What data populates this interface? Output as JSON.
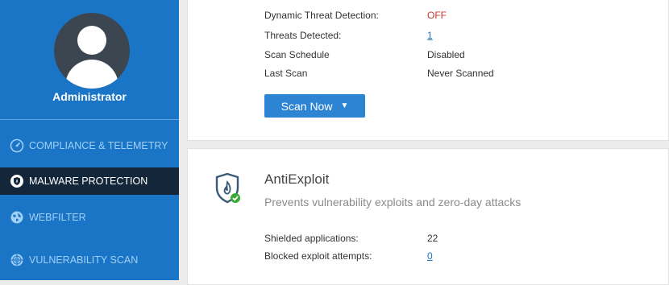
{
  "sidebar": {
    "user_name": "Administrator",
    "nav": [
      {
        "label": "COMPLIANCE & TELEMETRY",
        "icon": "gauge-icon",
        "active": false
      },
      {
        "label": "MALWARE PROTECTION",
        "icon": "malware-shield-icon",
        "active": true
      },
      {
        "label": "WEBFILTER",
        "icon": "globe-icon",
        "active": false
      },
      {
        "label": "VULNERABILITY SCAN",
        "icon": "radar-icon",
        "active": false
      }
    ]
  },
  "malware_status": {
    "rows": [
      {
        "label": "Dynamic Threat Detection:",
        "value": "OFF"
      },
      {
        "label": "Threats Detected:",
        "value": "1"
      },
      {
        "label": "Scan Schedule",
        "value": "Disabled"
      },
      {
        "label": "Last Scan",
        "value": "Never Scanned"
      }
    ],
    "scan_button": "Scan Now"
  },
  "antiexploit": {
    "title": "AntiExploit",
    "description": "Prevents vulnerability exploits and zero-day attacks",
    "icon": "shield-flame-check-icon",
    "rows": [
      {
        "label": "Shielded applications:",
        "value": "22"
      },
      {
        "label": "Blocked exploit attempts:",
        "value": "0"
      }
    ]
  },
  "colors": {
    "sidebar_bg": "#1b75c6",
    "active_nav_bg": "#14273a",
    "accent": "#2d84d2",
    "off_red": "#c0392b",
    "check_green": "#3aaa35"
  }
}
